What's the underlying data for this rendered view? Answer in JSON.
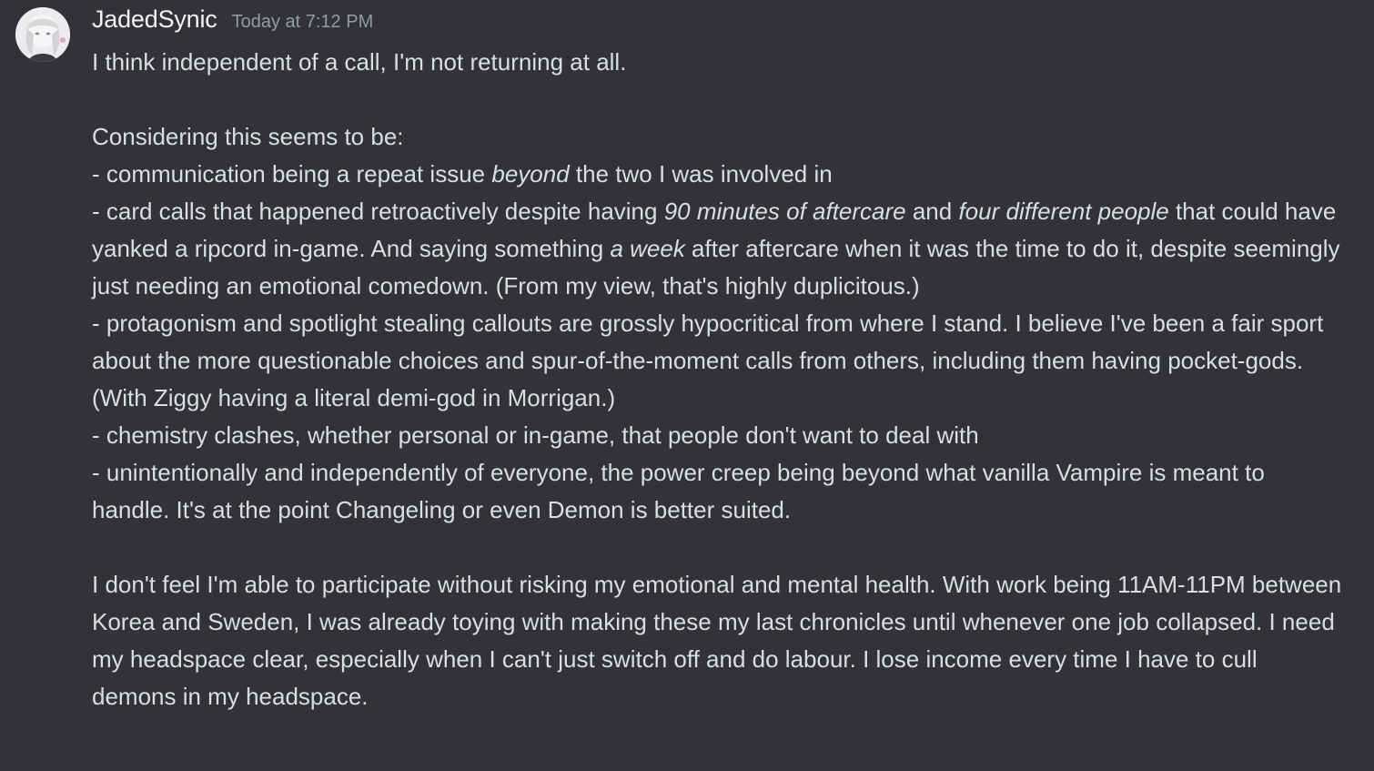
{
  "message": {
    "username": "JadedSynic",
    "timestamp": "Today at 7:12 PM",
    "avatar_icon": "user-avatar-icon",
    "line1": "I think independent of a call, I'm not returning at all.",
    "line2": "Considering this seems to be:",
    "bullet1": {
      "a": "- communication being a repeat issue ",
      "b": "beyond",
      "c": " the two I was involved in"
    },
    "bullet2": {
      "a": "- card calls that happened retroactively despite having ",
      "b": "90 minutes of aftercare",
      "c": " and ",
      "d": "four different people",
      "e": " that could have yanked a ripcord in-game. And saying something ",
      "f": "a week",
      "g": " after aftercare when it was the time to do it, despite seemingly just needing an emotional comedown. (From my view, that's highly duplicitous.)"
    },
    "bullet3": "- protagonism and spotlight stealing callouts are grossly hypocritical from where I stand. I believe I've been a fair sport about the more questionable choices and spur-of-the-moment calls from others, including them having pocket-gods. (With Ziggy having a literal demi-god in Morrigan.)",
    "bullet4": "- chemistry clashes, whether personal or in-game, that people don't want to deal with",
    "bullet5": "- unintentionally and independently of everyone, the power creep being beyond what vanilla Vampire is meant to handle. It's at the point Changeling or even Demon is better suited.",
    "closing": "I don't feel I'm able to participate without risking my emotional and mental health. With work being 11AM-11PM between Korea and Sweden, I was already toying with making these my last chronicles until whenever one job collapsed. I need my headspace clear, especially when I can't just switch off and do labour. I lose income every time I have to cull demons in my headspace."
  },
  "colors": {
    "background": "#313338",
    "username": "#f2f3f5",
    "timestamp": "#949ba4",
    "text": "#dbdee1"
  }
}
